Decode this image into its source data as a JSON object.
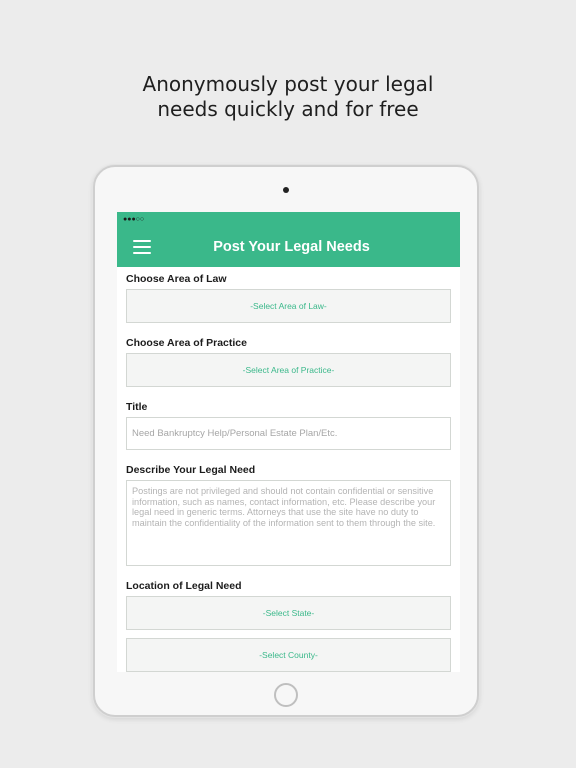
{
  "headline": {
    "line1": "Anonymously post your legal",
    "line2": "needs quickly and for free"
  },
  "status_bar": {
    "signal": "●●●○○"
  },
  "header": {
    "title": "Post Your Legal Needs",
    "menu_icon": "hamburger-menu-icon",
    "color": "#3ab88a"
  },
  "form": {
    "area_of_law": {
      "label": "Choose Area of Law",
      "value": "-Select Area of Law-"
    },
    "area_of_practice": {
      "label": "Choose Area of Practice",
      "value": "-Select Area of Practice-"
    },
    "title": {
      "label": "Title",
      "placeholder": "Need Bankruptcy Help/Personal Estate Plan/Etc."
    },
    "describe": {
      "label": "Describe Your Legal Need",
      "placeholder": "Postings are not privileged and should not contain confidential or sensitive information, such as names, contact information, etc. Please describe your legal need in generic terms. Attorneys that use the site have no duty to maintain the confidentiality of the information sent to them through the site."
    },
    "location": {
      "label": "Location of Legal Need",
      "state_value": "-Select State-",
      "county_value": "-Select County-"
    }
  }
}
